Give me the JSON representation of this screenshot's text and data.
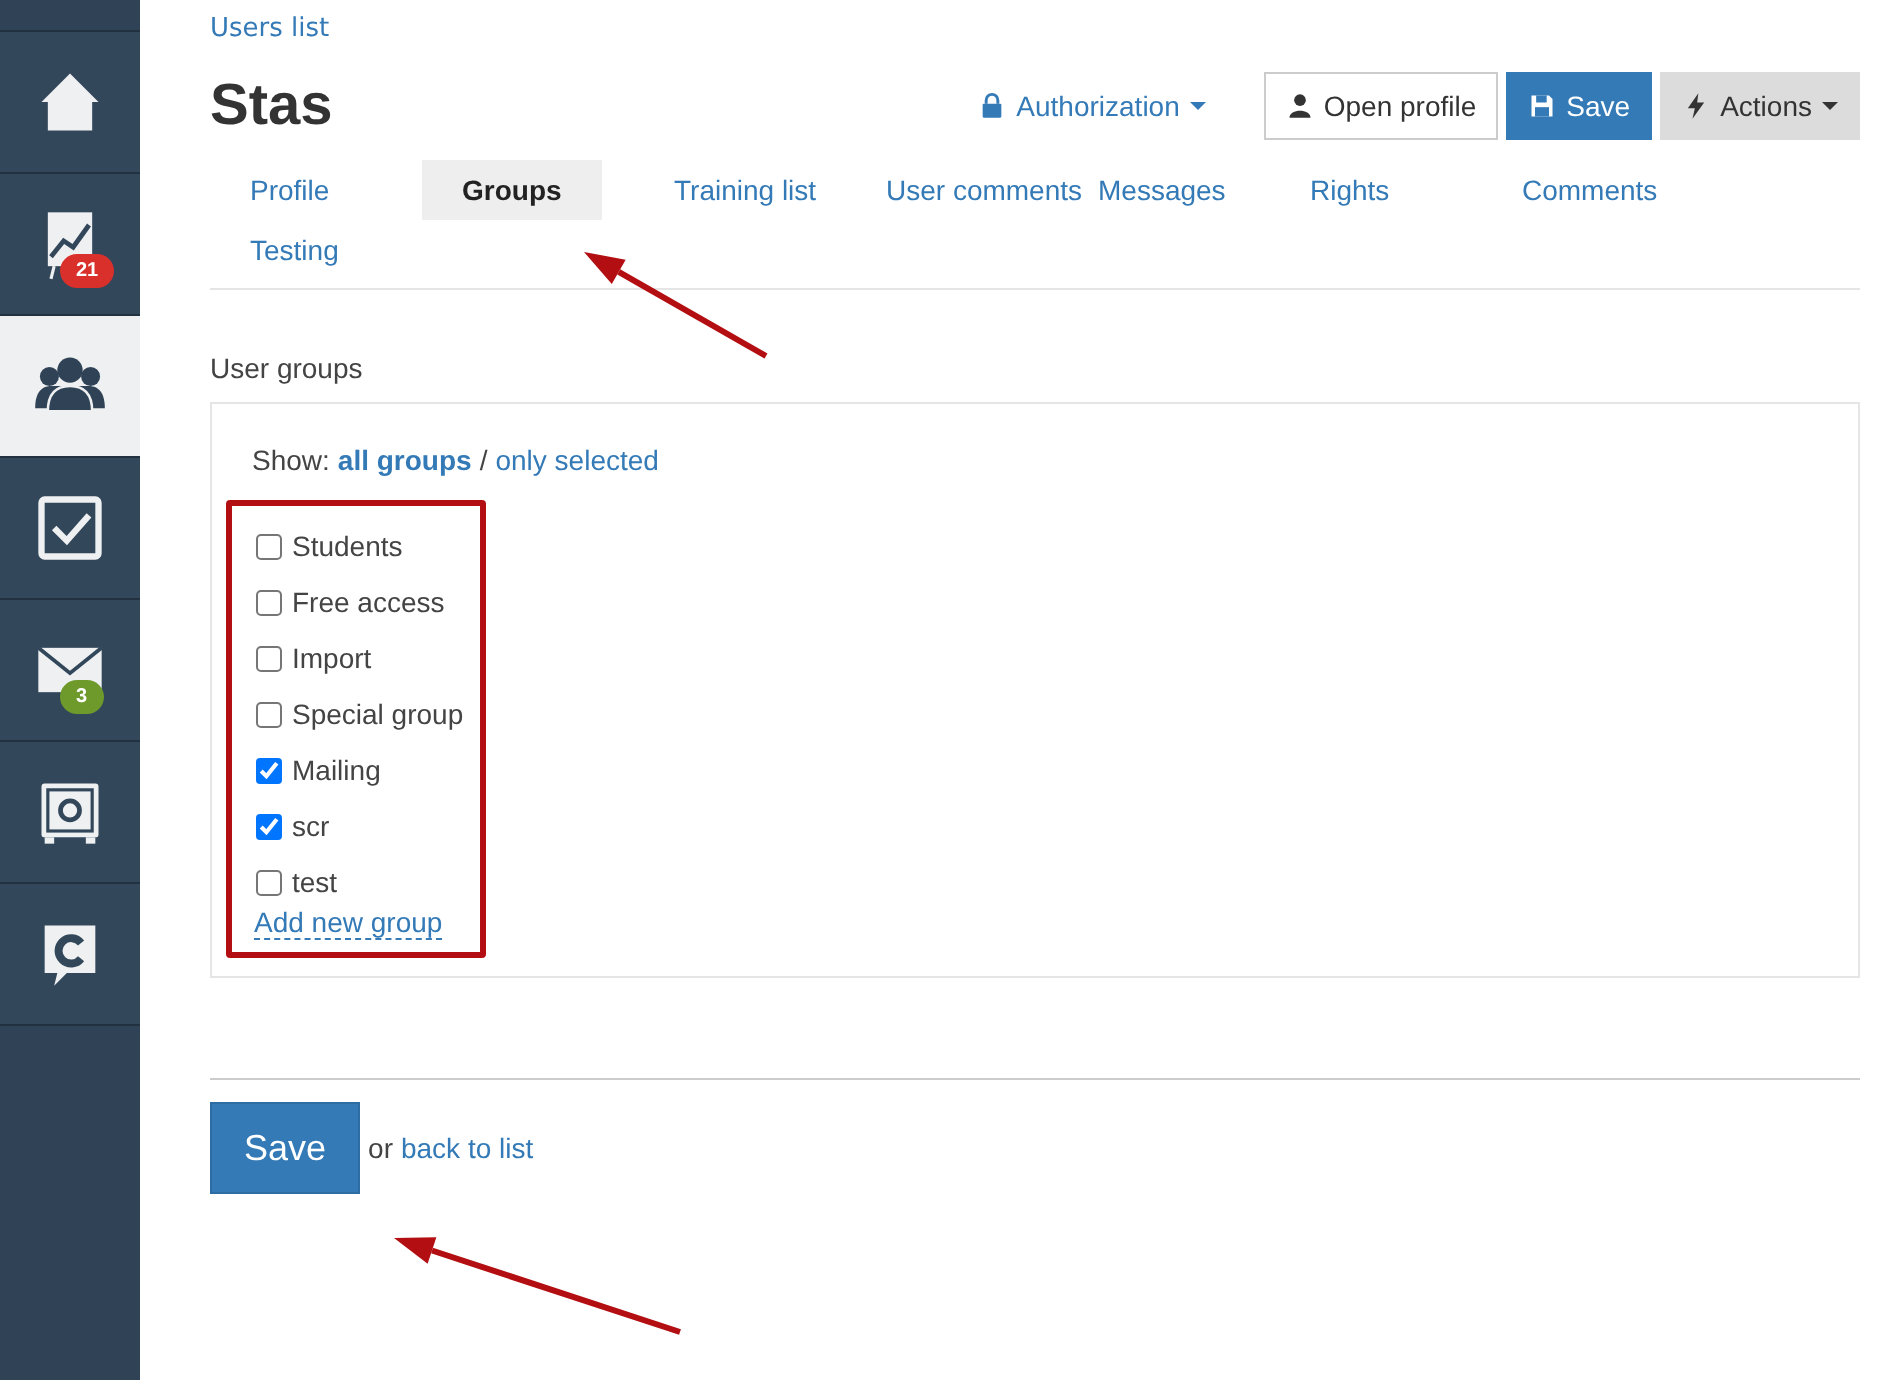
{
  "sidebar": {
    "items": [
      {
        "kind": "home",
        "selected": false
      },
      {
        "kind": "chart",
        "selected": false,
        "badge": "21",
        "color": "#d9302c"
      },
      {
        "kind": "users",
        "selected": true
      },
      {
        "kind": "tasks",
        "selected": false
      },
      {
        "kind": "mail",
        "selected": false,
        "badge": "3",
        "color": "#6e9a2c"
      },
      {
        "kind": "safe",
        "selected": false
      },
      {
        "kind": "chat",
        "selected": false
      }
    ]
  },
  "breadcrumb": "Users list",
  "title": "Stas",
  "header_actions": [
    {
      "kind": "link",
      "label": "Authorization",
      "caret": true
    },
    {
      "kind": "default",
      "label": "Open profile",
      "caret": false
    },
    {
      "kind": "primary",
      "label": "Save",
      "caret": false
    },
    {
      "kind": "grey",
      "label": "Actions",
      "caret": true
    }
  ],
  "tabs": [
    {
      "label": "Profile",
      "selected": false
    },
    {
      "label": "Groups",
      "selected": true
    },
    {
      "label": "Training list",
      "selected": false
    },
    {
      "label": "User comments",
      "selected": false
    },
    {
      "label": "Messages",
      "selected": false
    },
    {
      "label": "Rights",
      "selected": false
    },
    {
      "label": "Comments",
      "selected": false
    },
    {
      "label": "Testing",
      "selected": false
    }
  ],
  "section_title": "User groups",
  "show": {
    "label": "Show:",
    "separator": "/",
    "options": [
      {
        "label": "all groups",
        "selected": true
      },
      {
        "label": "only selected",
        "selected": false
      }
    ]
  },
  "groups": [
    {
      "label": "Students",
      "checked": false
    },
    {
      "label": "Free access",
      "checked": false
    },
    {
      "label": "Import",
      "checked": false
    },
    {
      "label": "Special group",
      "checked": false
    },
    {
      "label": "Mailing",
      "checked": true
    },
    {
      "label": "scr",
      "checked": true
    },
    {
      "label": "test",
      "checked": false
    }
  ],
  "add_group": "Add new group",
  "footer": {
    "save": "Save",
    "or": "or",
    "back": "back to list"
  }
}
